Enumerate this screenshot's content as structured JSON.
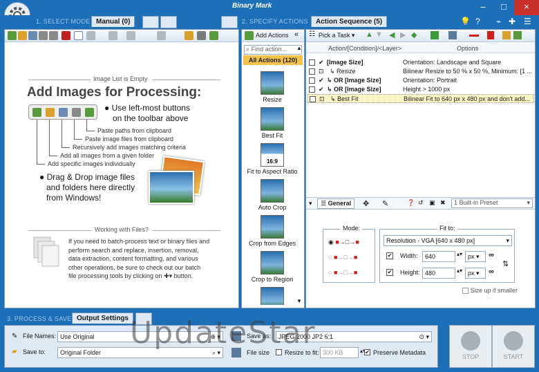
{
  "app": {
    "logo": "Binary Mark"
  },
  "window_controls": [
    "–",
    "□",
    "×"
  ],
  "stages": {
    "select_mode": "1. SELECT MODE",
    "specify_actions": "2. SPECIFY ACTIONS",
    "process_save": "3. PROCESS & SAVE"
  },
  "tabs": {
    "manual": "Manual (0)",
    "action_sequence": "Action Sequence (5)",
    "output_settings": "Output Settings"
  },
  "image_list": {
    "empty_label": "Image List is Empty",
    "headline": "Add Images for Processing:",
    "tip1": "Use left-most buttons",
    "tip1b": "on the toolbar above",
    "hints": [
      "Paste paths from clipboard",
      "Paste image files from clipboard",
      "Recursively add images matching criteria",
      "Add all images from a given folder",
      "Add specific images individually"
    ],
    "dragdrop1": "Drag & Drop image files",
    "dragdrop2": "and folders here directly",
    "dragdrop3": "from Windows!",
    "working_files": "Working with Files?",
    "para": [
      "If you need to batch-process text or binary files and",
      "perform search and replace, insertion, removal,",
      "data extraction, content formatting, and various",
      "other operations, be sure to check out our batch",
      "file processing tools by clicking on"
    ],
    "para_end": "button."
  },
  "actions_panel": {
    "add_actions": "Add Actions",
    "find_placeholder": "Find action...",
    "all_actions": "All Actions (120)",
    "items": [
      "Resize",
      "Best Fit",
      "Fit to Aspect Ratio",
      "Auto Crop",
      "Crop from Edges",
      "Crop to Region"
    ],
    "thumb_label": "16:9"
  },
  "sequence": {
    "pick_task": "Pick a Task",
    "col_action": "Action/[Condition]/<Layer>",
    "col_options": "Options",
    "rows": [
      {
        "action": "[Image Size]",
        "options": "Orientation: Landscape and Square",
        "bold": true
      },
      {
        "action": "↳ Resize",
        "options": "Bilinear Resize to 50 % x 50 %, Minimum: [1 ...",
        "bold": false
      },
      {
        "action": "↳ OR [Image Size]",
        "options": "Orientation: Portrait",
        "bold": true
      },
      {
        "action": "↳ OR [Image Size]",
        "options": "Height > 1000 px",
        "bold": true
      },
      {
        "action": "↳ Best Fit",
        "options": "Bilinear Fit to 640 px x 480 px and don't add...",
        "bold": false
      }
    ]
  },
  "properties": {
    "tab_general": "General",
    "preset": "1 Built-in Preset",
    "mode_label": "Mode:",
    "fit_to_label": "Fit to:",
    "resolution": "Resolution - VGA [640 x 480 px]",
    "width_label": "Width:",
    "width_value": "640",
    "height_label": "Height:",
    "height_value": "480",
    "unit": "px",
    "size_up": "Size up if smaller"
  },
  "output": {
    "file_names_label": "File Names:",
    "file_names_value": "Use Original",
    "save_to_label": "Save to:",
    "save_to_value": "Original Folder",
    "save_as_label": "Save as:",
    "save_as_value": "JPEG 2000 JP2 6:1",
    "file_size_label": "File size",
    "resize_to_fit": "Resize to fit:",
    "resize_value": "300 KB",
    "preserve_metadata": "Preserve Metadata",
    "stop": "STOP",
    "start": "START"
  },
  "watermark": "UpdateStar",
  "colors": {
    "chrome": "#1d6fb8",
    "panel": "#dfe9f4",
    "selected_row": "#fff7c8",
    "red_icon": "#d21c1c"
  }
}
